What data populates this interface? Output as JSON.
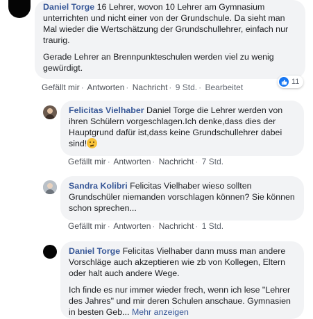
{
  "comments": [
    {
      "author": "Daniel Torge",
      "paragraphs": [
        "16 Lehrer, wovon 10 Lehrer am Gymnasium unterrichten und nicht einer von der Grundschule. Da sieht man Mal wieder die Wertschätzung der Grundschullehrer, einfach nur traurig.",
        "Gerade Lehrer an Brennpunkteschulen werden viel zu wenig gewürdigt."
      ],
      "actions": {
        "like": "Gefällt mir",
        "reply": "Antworten",
        "message": "Nachricht",
        "time": "9 Std.",
        "edited": "Bearbeitet"
      },
      "reaction_count": "11"
    },
    {
      "author": "Felicitas Vielhaber",
      "text": "Daniel Torge die Lehrer werden von ihren Schülern vorgeschlagen.Ich denke,dass dies der Hauptgrund dafür ist,dass keine Grundschullehrer dabei sind!",
      "actions": {
        "like": "Gefällt mir",
        "reply": "Antworten",
        "message": "Nachricht",
        "time": "7 Std."
      }
    },
    {
      "author": "Sandra Kolibri",
      "text": "Felicitas Vielhaber wieso sollten Grundschüler niemanden vorschlagen können? Sie können schon sprechen...",
      "actions": {
        "like": "Gefällt mir",
        "reply": "Antworten",
        "message": "Nachricht",
        "time": "1 Std."
      }
    },
    {
      "author": "Daniel Torge",
      "paragraphs": [
        "Felicitas Vielhaber dann muss man andere Vorschläge auch akzeptieren wie zb von Kollegen, Eltern oder halt auch andere Wege.",
        "Ich finde es nur immer wieder frech, wenn ich lese \"Lehrer des Jahres\" und mir deren Schulen anschaue. Gymnasien in besten Geb..."
      ],
      "see_more": "Mehr anzeigen"
    }
  ],
  "colors": {
    "link": "#385898",
    "bubble": "#f2f3f5",
    "like_blue": "#1877f2"
  },
  "icons": {
    "like": "thumbs-up-icon",
    "emoji": "thinking-face-emoji"
  }
}
